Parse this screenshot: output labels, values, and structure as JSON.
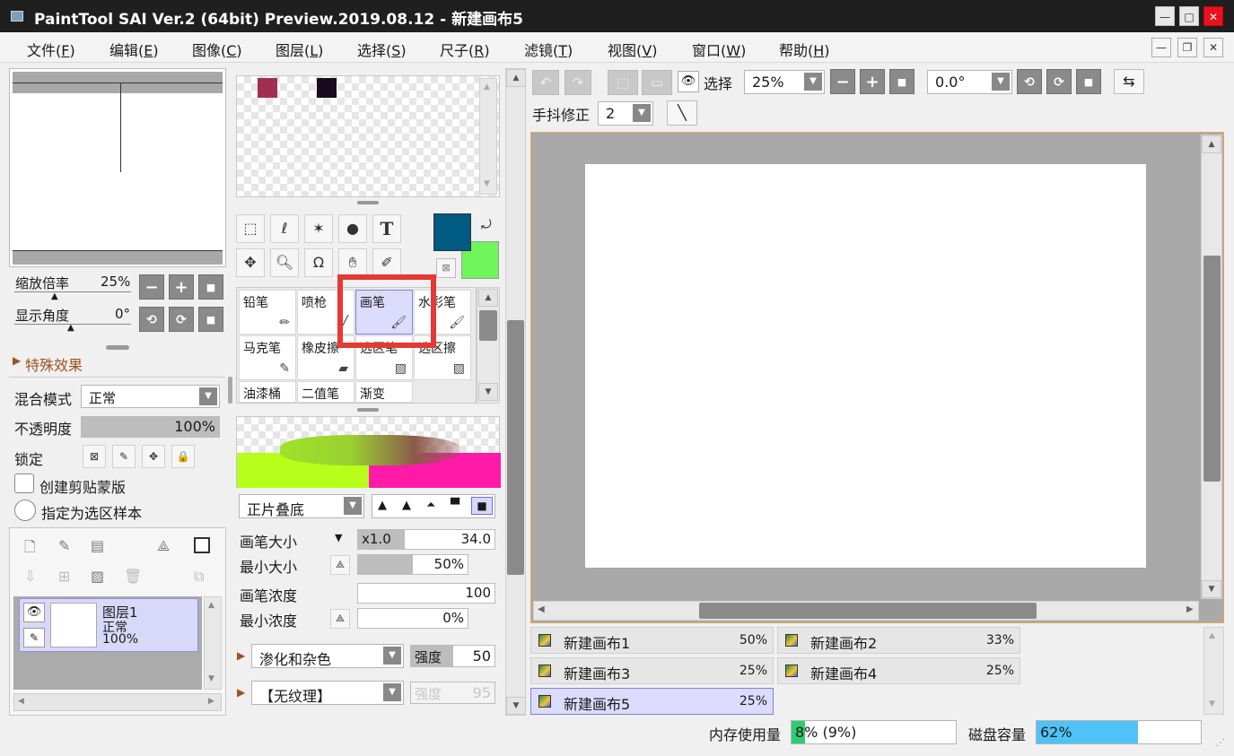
{
  "window": {
    "title": "PaintTool SAI Ver.2 (64bit) Preview.2019.08.12 - 新建画布5"
  },
  "menu": [
    {
      "text": "文件(",
      "key": "F",
      "end": ")"
    },
    {
      "text": "编辑(",
      "key": "E",
      "end": ")"
    },
    {
      "text": "图像(",
      "key": "C",
      "end": ")"
    },
    {
      "text": "图层(",
      "key": "L",
      "end": ")"
    },
    {
      "text": "选择(",
      "key": "S",
      "end": ")"
    },
    {
      "text": "尺子(",
      "key": "R",
      "end": ")"
    },
    {
      "text": "滤镜(",
      "key": "T",
      "end": ")"
    },
    {
      "text": "视图(",
      "key": "V",
      "end": ")"
    },
    {
      "text": "窗口(",
      "key": "W",
      "end": ")"
    },
    {
      "text": "帮助(",
      "key": "H",
      "end": ")"
    }
  ],
  "navigator": {
    "zoom_label": "缩放倍率",
    "zoom_value": "25%",
    "angle_label": "显示角度",
    "angle_value": "0°"
  },
  "effects": {
    "label": "特殊效果"
  },
  "layer_props": {
    "blend_label": "混合模式",
    "blend_value": "正常",
    "opacity_label": "不透明度",
    "opacity_value": "100%",
    "lock_label": "锁定",
    "clip_label": "创建剪贴蒙版",
    "sample_label": "指定为选区样本"
  },
  "layer": {
    "name": "图层1",
    "mode": "正常",
    "opacity": "100%"
  },
  "colors": {
    "primary": "#005a82",
    "secondary": "#6ef55a",
    "swatch1": "#a03050",
    "swatch2": "#1a0a1e",
    "accent_highlight": "#e53935"
  },
  "brushes": [
    {
      "name": "铅笔",
      "icon": "pencil-icon"
    },
    {
      "name": "喷枪",
      "icon": "airbrush-icon"
    },
    {
      "name": "画笔",
      "icon": "brush-icon",
      "selected": true
    },
    {
      "name": "水彩笔",
      "icon": "watercolor-icon"
    },
    {
      "name": "马克笔",
      "icon": "marker-icon"
    },
    {
      "name": "橡皮擦",
      "icon": "eraser-icon"
    },
    {
      "name": "选区笔",
      "icon": "select-pen-icon"
    },
    {
      "name": "选区擦",
      "icon": "select-eraser-icon"
    },
    {
      "name": "油漆桶",
      "icon": "bucket-icon"
    },
    {
      "name": "二值笔",
      "icon": "binary-pen-icon"
    },
    {
      "name": "渐变",
      "icon": "gradient-icon"
    }
  ],
  "brush_settings": {
    "blend_value": "正片叠底",
    "size_label": "画笔大小",
    "size_mult": "x1.0",
    "size_value": "34.0",
    "min_size_label": "最小大小",
    "min_size_value": "50%",
    "density_label": "画笔浓度",
    "density_value": "100",
    "min_density_label": "最小浓度",
    "min_density_value": "0%",
    "texture_combo": "渗化和杂色",
    "strength_label": "强度",
    "strength_value": "50",
    "texture2_combo": "【无纹理】",
    "strength2_label": "强度",
    "strength2_value": "95"
  },
  "toolbar": {
    "select_label": "选择",
    "zoom_value": "25%",
    "angle_value": "0.0°",
    "stabilizer_label": "手抖修正",
    "stabilizer_value": "2"
  },
  "canvas_tabs": [
    {
      "name": "新建画布1",
      "zoom": "50%"
    },
    {
      "name": "新建画布2",
      "zoom": "33%"
    },
    {
      "name": "新建画布3",
      "zoom": "25%"
    },
    {
      "name": "新建画布4",
      "zoom": "25%"
    },
    {
      "name": "新建画布5",
      "zoom": "25%",
      "active": true
    }
  ],
  "status": {
    "memory_label": "内存使用量",
    "memory_value": "8% (9%)",
    "memory_fraction": 0.08,
    "disk_label": "磁盘容量",
    "disk_value": "62%",
    "disk_fraction": 0.62
  }
}
